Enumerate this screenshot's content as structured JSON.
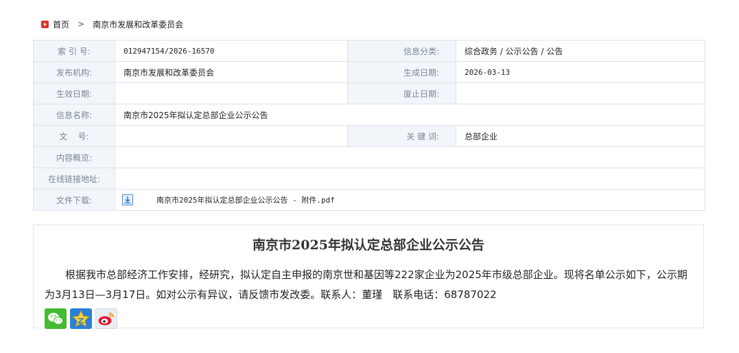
{
  "breadcrumb": {
    "home": "首页",
    "separator": ">",
    "current": "南京市发展和改革委员会"
  },
  "meta": {
    "index_label": "索 引 号:",
    "index_value": "012947154/2026-16570",
    "category_label": "信息分类:",
    "category_value": "综合政务 / 公示公告 / 公告",
    "publisher_label": "发布机构:",
    "publisher_value": "南京市发展和改革委员会",
    "created_label": "生成日期:",
    "created_value": "2026-03-13",
    "effective_label": "生效日期:",
    "effective_value": "",
    "expire_label": "废止日期:",
    "expire_value": "",
    "name_label": "信息名称:",
    "name_value": "南京市2025年拟认定总部企业公示公告",
    "docno_label": "文    号:",
    "docno_value": "",
    "keywords_label": "关 键 词:",
    "keywords_value": "总部企业",
    "summary_label": "内容概览:",
    "summary_value": "",
    "link_label": "在线链接地址:",
    "link_value": "",
    "download_label": "文件下载:",
    "download_value": "南京市2025年拟认定总部企业公示公告 - 附件.pdf"
  },
  "article": {
    "title": "南京市2025年拟认定总部企业公示公告",
    "body": "根据我市总部经济工作安排，经研究，拟认定自主申报的南京世和基因等222家企业为2025年市级总部企业。现将名单公示如下，公示期为3月13日—3月17日。如对公示有异议，请反馈市发改委。联系人：董瑾　联系电话：68787022"
  },
  "share": {
    "icons": [
      "wechat-icon",
      "qzone-icon",
      "weibo-icon"
    ]
  },
  "colors": {
    "label_bg": "#f2f6fa",
    "label_text": "#7a8796",
    "border": "#dde3ea",
    "home_icon": "#d9362a"
  }
}
